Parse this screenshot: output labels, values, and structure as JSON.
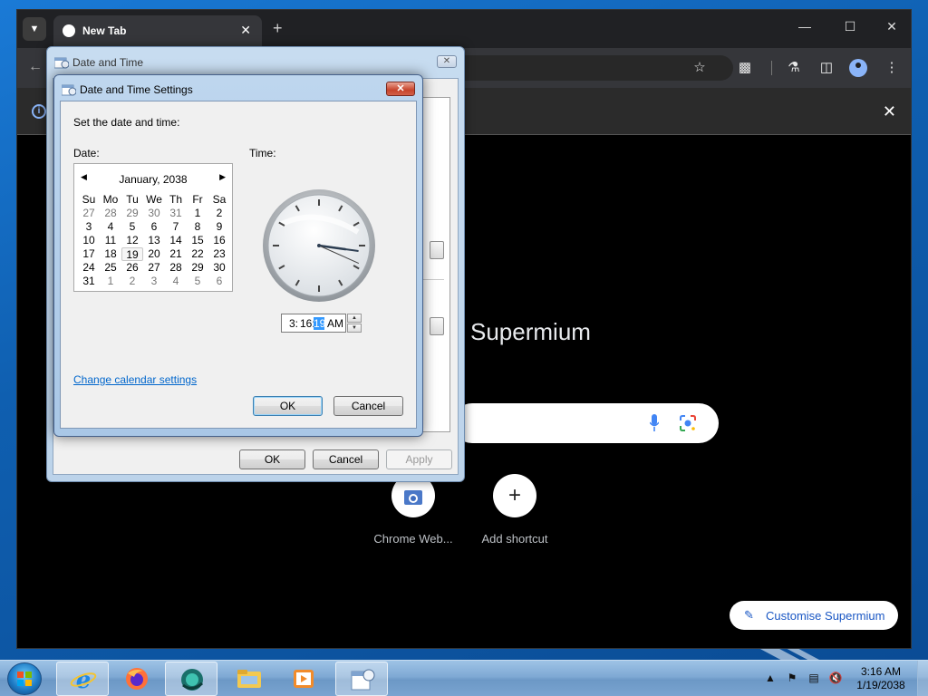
{
  "browser": {
    "tab_title": "New Tab",
    "ntp_title": "Supermium",
    "shortcuts": [
      {
        "label": "Chrome Web..."
      },
      {
        "label": "Add shortcut"
      }
    ],
    "customise_label": "Customise Supermium"
  },
  "date_time_window": {
    "title": "Date and Time",
    "ok_label": "OK",
    "cancel_label": "Cancel",
    "apply_label": "Apply"
  },
  "settings_dialog": {
    "title": "Date and Time Settings",
    "instruction": "Set the date and time:",
    "date_label": "Date:",
    "time_label": "Time:",
    "month_label": "January, 2038",
    "weekdays": [
      "Su",
      "Mo",
      "Tu",
      "We",
      "Th",
      "Fr",
      "Sa"
    ],
    "weeks": [
      [
        "27",
        "28",
        "29",
        "30",
        "31",
        "1",
        "2"
      ],
      [
        "3",
        "4",
        "5",
        "6",
        "7",
        "8",
        "9"
      ],
      [
        "10",
        "11",
        "12",
        "13",
        "14",
        "15",
        "16"
      ],
      [
        "17",
        "18",
        "19",
        "20",
        "21",
        "22",
        "23"
      ],
      [
        "24",
        "25",
        "26",
        "27",
        "28",
        "29",
        "30"
      ],
      [
        "31",
        "1",
        "2",
        "3",
        "4",
        "5",
        "6"
      ]
    ],
    "selected_day": "19",
    "time": {
      "hour": "3:",
      "minute": "16:",
      "second": "19",
      "ampm": "AM"
    },
    "change_calendar_link": "Change calendar settings",
    "ok_label": "OK",
    "cancel_label": "Cancel"
  },
  "taskbar": {
    "clock_time": "3:16 AM",
    "clock_date": "1/19/2038"
  }
}
